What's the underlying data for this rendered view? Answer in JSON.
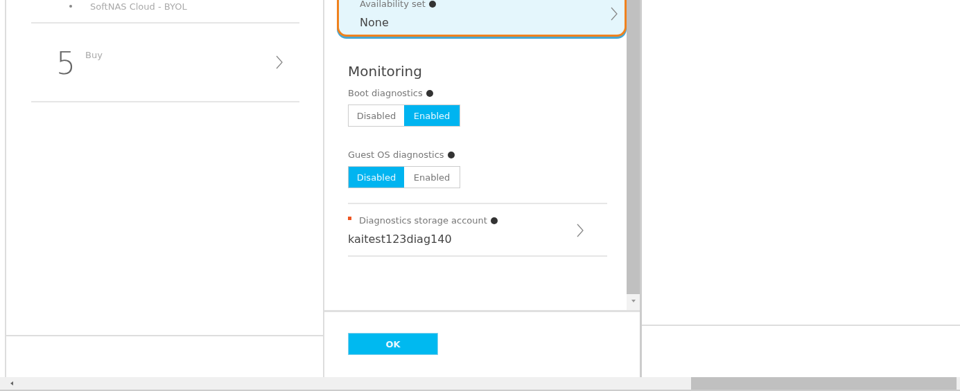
{
  "left_blade": {
    "bullet_item": "SoftNAS Cloud - BYOL",
    "steps": [
      {
        "number": "5",
        "label": "Buy"
      }
    ]
  },
  "settings_blade": {
    "availability_set": {
      "label": "Availability set",
      "value": "None",
      "selected": true
    },
    "section_title": "Monitoring",
    "toggles": [
      {
        "label": "Boot diagnostics",
        "options": [
          {
            "label": "Disabled",
            "selected": false
          },
          {
            "label": "Enabled",
            "selected": true
          }
        ]
      },
      {
        "label": "Guest OS diagnostics",
        "options": [
          {
            "label": "Disabled",
            "selected": true
          },
          {
            "label": "Enabled",
            "selected": false
          }
        ]
      }
    ],
    "storage_account": {
      "label": "Diagnostics storage account",
      "required": true,
      "value": "kaitest123diag140"
    },
    "ok_button": "OK"
  }
}
